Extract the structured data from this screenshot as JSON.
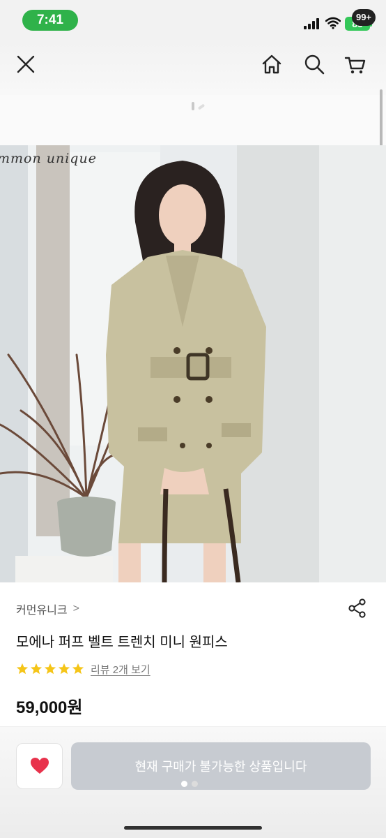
{
  "status_bar": {
    "time": "7:41",
    "battery": "85"
  },
  "nav": {
    "cart_badge": "99+"
  },
  "product": {
    "brand_watermark": "mmon unique",
    "brand_name": "커먼유니크",
    "brand_chevron": ">",
    "title": "모에나 퍼프 벨트 트렌치 미니 원피스",
    "rating_stars": 5,
    "review_link": "리뷰 2개 보기",
    "price": "59,000원"
  },
  "bottom": {
    "buy_label": "현재 구매가 불가능한 상품입니다"
  },
  "colors": {
    "status_time_bg": "#2fb24a",
    "battery": "#34c759",
    "star": "#f5c518",
    "heart": "#e8324c",
    "button_disabled": "#c7cbd1"
  }
}
